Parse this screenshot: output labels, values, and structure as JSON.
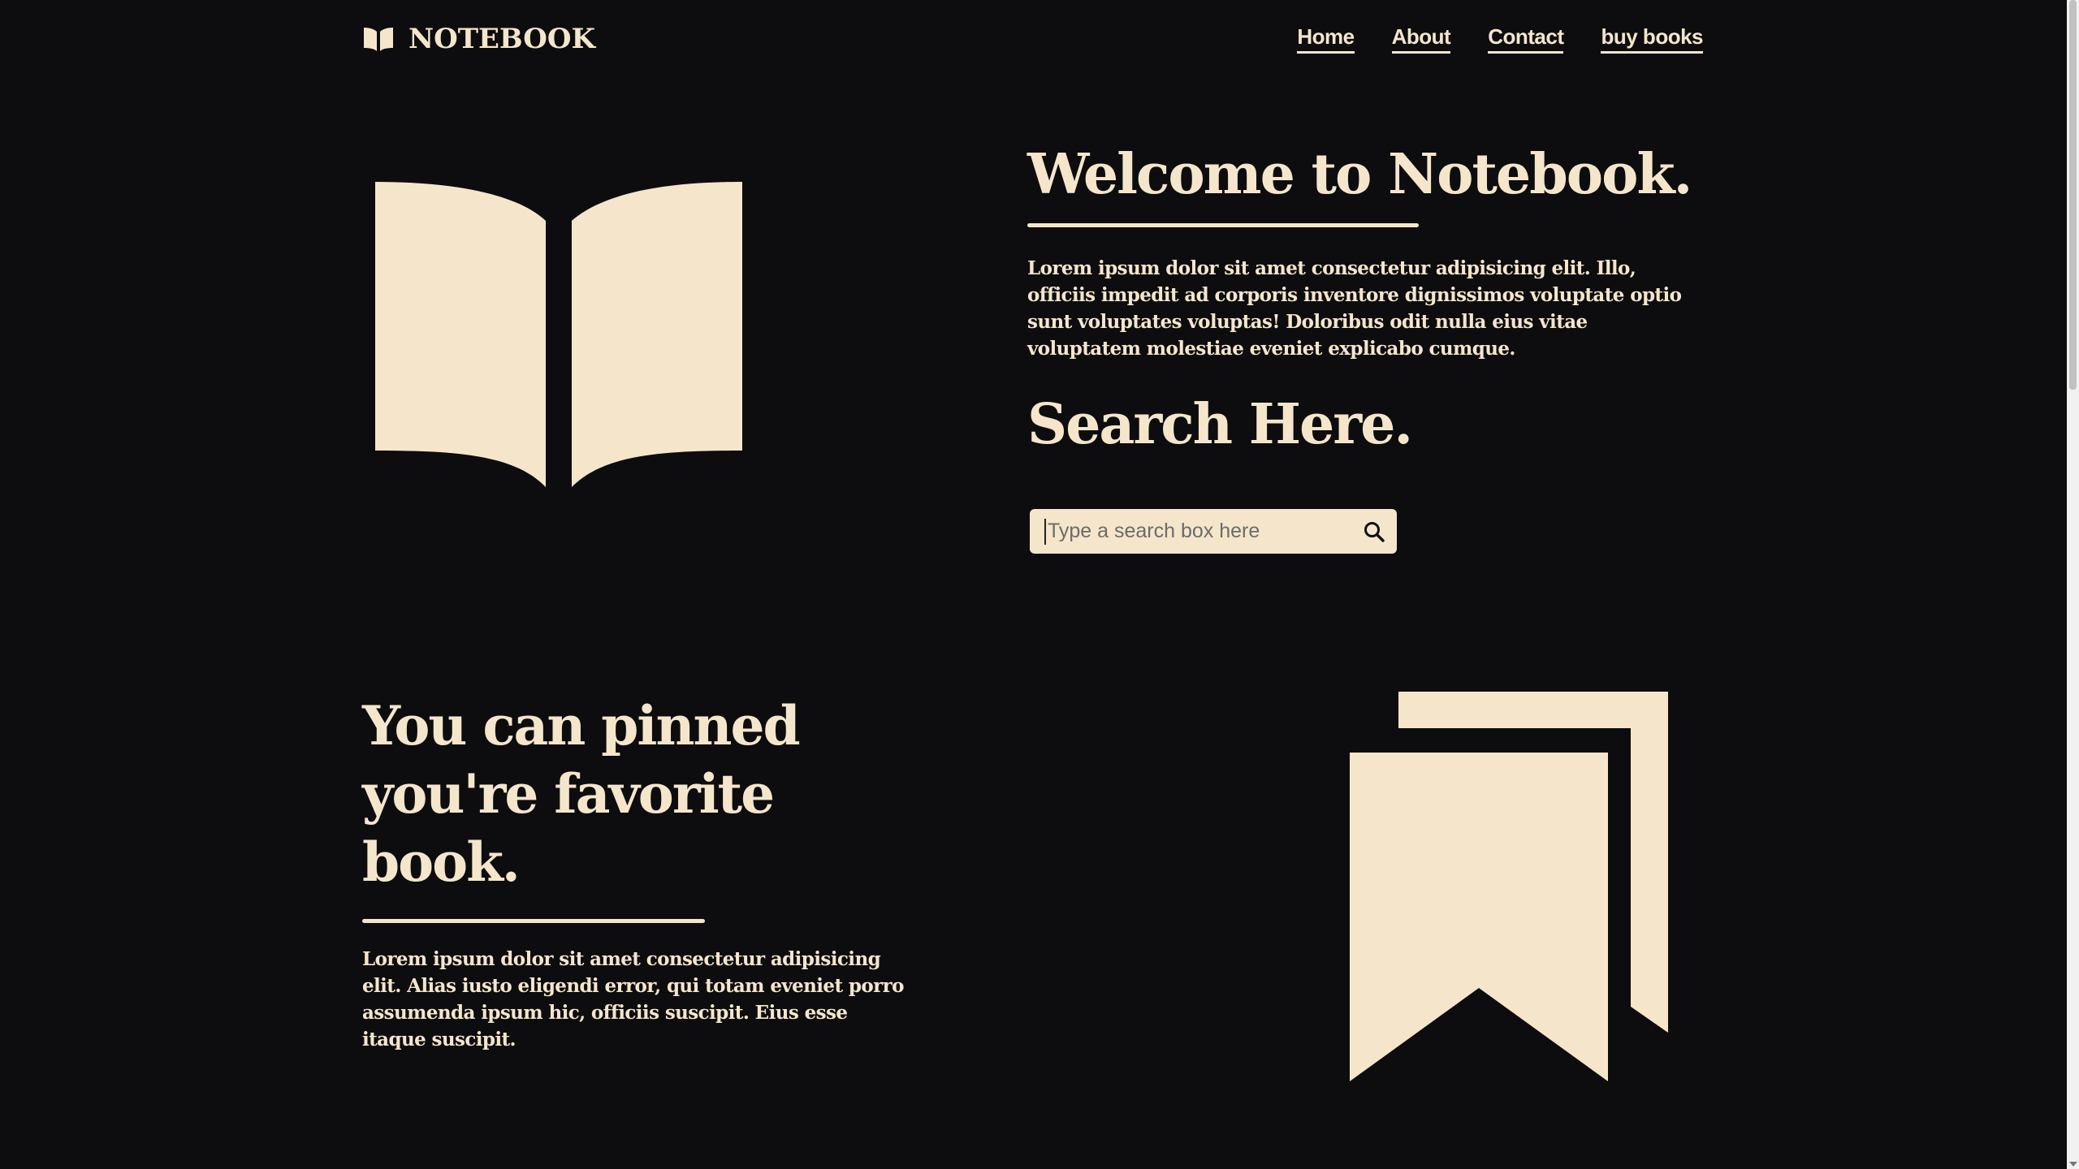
{
  "header": {
    "brand_name": "NOTEBOOK",
    "brand_icon": "open-book-icon",
    "nav": [
      {
        "label": "Home"
      },
      {
        "label": "About"
      },
      {
        "label": "Contact"
      },
      {
        "label": "buy books"
      }
    ]
  },
  "hero": {
    "illustration": "open-book-icon",
    "title": "Welcome to Notebook.",
    "body": "Lorem ipsum dolor sit amet consectetur adipisicing elit. Illo, officiis impedit ad corporis inventore dignissimos voluptate optio sunt voluptates voluptas! Doloribus odit nulla eius vitae voluptatem molestiae eveniet explicabo cumque.",
    "search_title": "Search Here.",
    "search": {
      "placeholder": "Type a search box here",
      "value": "",
      "icon": "search-icon"
    }
  },
  "pinned": {
    "title_line1": "You can pinned",
    "title_line2": "you're favorite book.",
    "body": "Lorem ipsum dolor sit amet consectetur adipisicing elit. Alias iusto eligendi error, qui totam eveniet porro assumenda ipsum hic, officiis suscipit. Eius esse itaque suscipit.",
    "illustration": "bookmarks-icon"
  },
  "colors": {
    "background": "#0d0d0f",
    "accent": "#f5e6cb"
  }
}
